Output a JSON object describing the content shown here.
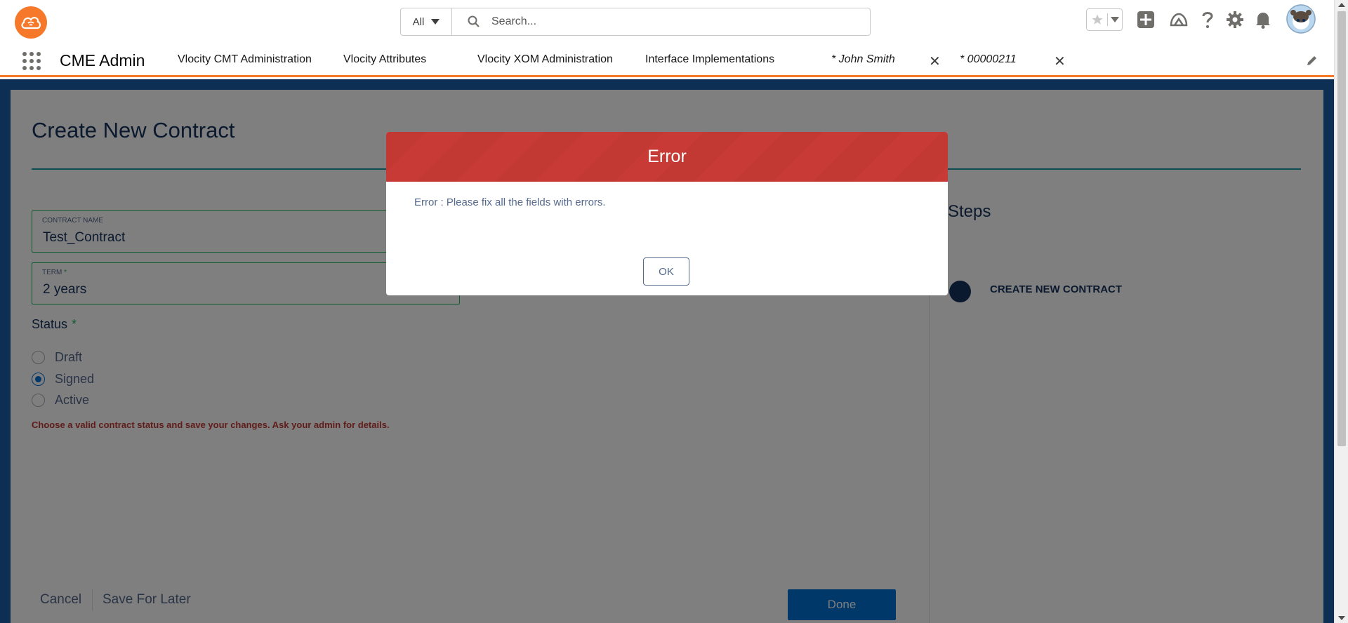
{
  "header": {
    "search": {
      "scope": "All",
      "placeholder": "Search..."
    }
  },
  "nav": {
    "app_name": "CME Admin",
    "items": [
      {
        "label": "Vlocity CMT Administration",
        "has_dropdown": false
      },
      {
        "label": "Vlocity Attributes",
        "has_dropdown": true
      },
      {
        "label": "Vlocity XOM Administration",
        "has_dropdown": false
      },
      {
        "label": "Interface Implementations",
        "has_dropdown": true
      }
    ],
    "tabs": [
      {
        "label": "* John Smith"
      },
      {
        "label": "* 00000211"
      }
    ],
    "accent_color": "#f6782a"
  },
  "form": {
    "title": "Create New Contract",
    "contract_name": {
      "label": "CONTRACT NAME",
      "value": "Test_Contract"
    },
    "term": {
      "label": "TERM",
      "required_mark": "*",
      "value": "2 years"
    },
    "status": {
      "label": "Status",
      "required_mark": "*",
      "options": [
        {
          "label": "Draft",
          "selected": false
        },
        {
          "label": "Signed",
          "selected": true
        },
        {
          "label": "Active",
          "selected": false
        }
      ]
    },
    "error_message": "Choose a valid contract status and save your changes. Ask your admin for details.",
    "footer": {
      "cancel": "Cancel",
      "save_for_later": "Save For Later",
      "done": "Done"
    }
  },
  "steps": {
    "title": "Steps",
    "items": [
      {
        "label": "CREATE NEW CONTRACT"
      }
    ]
  },
  "modal": {
    "title": "Error",
    "message": "Error : Please fix all the fields with errors.",
    "ok": "OK",
    "header_color": "#c23934"
  }
}
